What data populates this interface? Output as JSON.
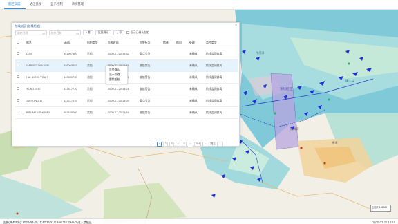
{
  "nav": {
    "tabs": [
      {
        "label": "航区调度",
        "active": true
      },
      {
        "label": "站位监视",
        "active": false
      },
      {
        "label": "显示控制",
        "active": false
      },
      {
        "label": "系统管理",
        "active": false
      }
    ]
  },
  "panel": {
    "title": "东线航区 (在线船舶)",
    "close": "×",
    "filters": {
      "start_date_placeholder": "起始日期",
      "end_date_placeholder": "结束日期",
      "search_btn": "查",
      "batch_confirm_btn": "批量确认",
      "export_btn": "导",
      "show_confirmed_label": "显示已确认船舶"
    },
    "columns": [
      "",
      "船名",
      "MMSI",
      "船舶类型",
      "告警时间",
      "告警行为",
      "航速",
      "航向",
      "处理",
      "监控类型"
    ],
    "rows": [
      {
        "name": "LUN",
        "mmsi": "441907500",
        "type": "货船",
        "time": "2020-07-20 15:52",
        "behavior": "重点关注",
        "speed": "",
        "course": "",
        "status": "未确认",
        "monitor": "航线监测偏离"
      },
      {
        "name": "GARNET BULKER",
        "mmsi": "538003002",
        "type": "货船",
        "time": "2020-07-20 15:45",
        "behavior": "偏航警告",
        "speed": "",
        "course": "",
        "status": "未确认",
        "monitor": "航线监测偏离"
      },
      {
        "name": "HAI SONG YOU 7",
        "mmsi": "413400790",
        "type": "油船",
        "time": "2020-07-20 15:36",
        "behavior": "偏航警告",
        "speed": "",
        "course": "",
        "status": "未确认",
        "monitor": "航线监测偏离"
      },
      {
        "name": "YONG JI 87",
        "mmsi": "413417710",
        "type": "货船",
        "time": "2020-07-20 15:21",
        "behavior": "偏航警告",
        "speed": "",
        "course": "",
        "status": "未确认",
        "monitor": "航线监测偏离"
      },
      {
        "name": "JIA HONG 17",
        "mmsi": "413217570",
        "type": "货船",
        "time": "2020-07-20 15:20",
        "behavior": "重点关注",
        "speed": "",
        "course": "",
        "status": "未确认",
        "monitor": "航线监测偏离"
      },
      {
        "name": "BITUMEN SHOURI",
        "mmsi": "563439000",
        "type": "货船",
        "time": "2020-07-20 15:16",
        "behavior": "偏航警告",
        "speed": "",
        "course": "",
        "status": "未确认",
        "monitor": "航线监测偏离"
      }
    ],
    "context_menu": [
      "告警确认",
      "显示轨迹",
      "跟踪船舶"
    ],
    "pager": {
      "prev": "‹",
      "pages": [
        "1",
        "2",
        "3",
        "4",
        "5",
        "…",
        "284"
      ],
      "next": "›",
      "jump_label": "跳至",
      "current": "1"
    }
  },
  "map": {
    "labels": [
      "东线航区",
      "深圳湾",
      "香港",
      "珠江口",
      "伶仃洋"
    ]
  },
  "footer": {
    "message": "告警(共455条): 2020-07-20 15:47:25 YUE HAI TIE 2 HAO 进入禁航区",
    "datetime": "2020-07-20 16:16",
    "scale": "比例尺 1:50000"
  },
  "colors": {
    "accent": "#2f8de4",
    "sea_deep": "#7fc9d8",
    "sea_shallow": "#c5e9d9",
    "land": "#f3f1ea",
    "ship": "#1f2fd8",
    "zone": "#b9a6e0"
  }
}
